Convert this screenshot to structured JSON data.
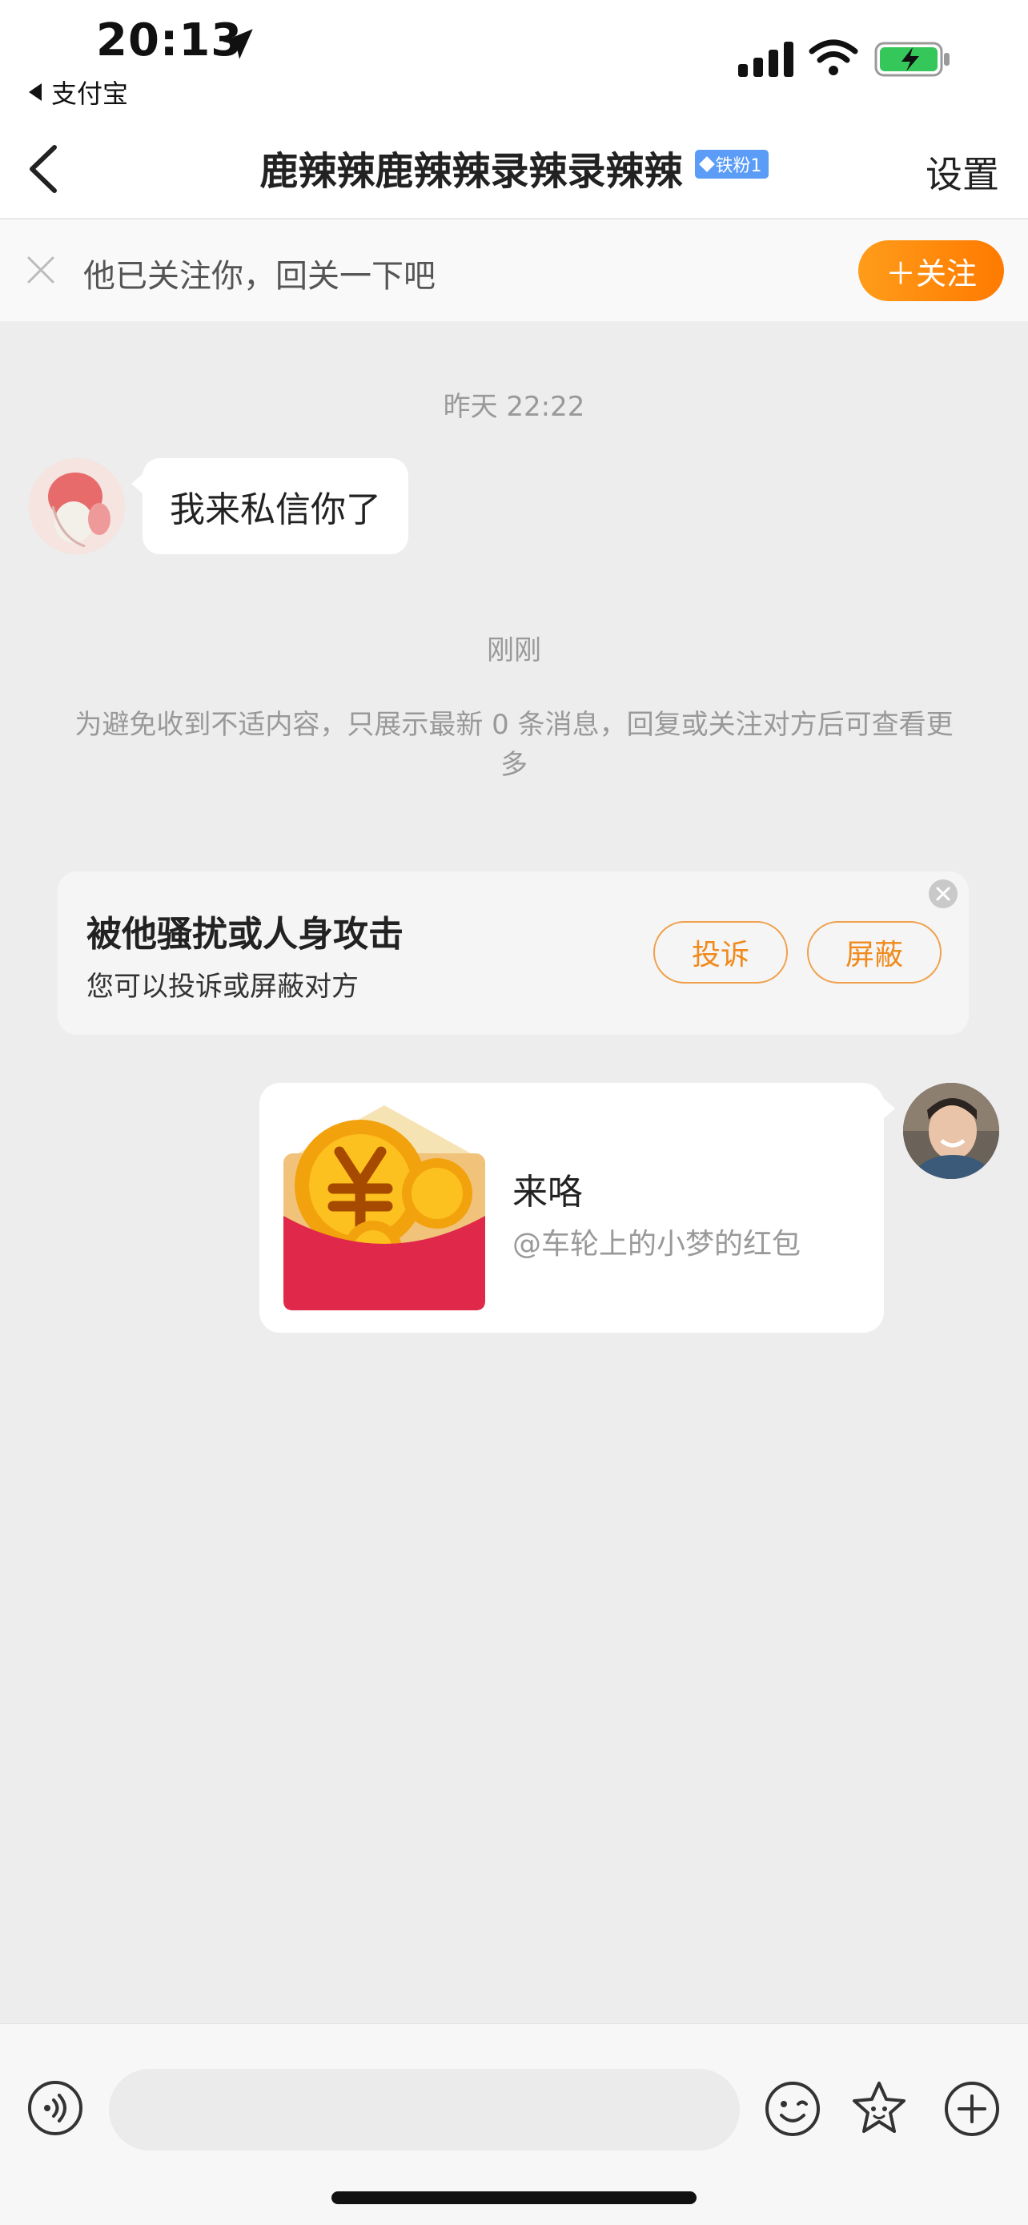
{
  "status_bar": {
    "time": "20:13",
    "back_app": "支付宝"
  },
  "nav": {
    "title": "鹿辣辣鹿辣辣录辣录辣辣",
    "badge": "铁粉1",
    "settings": "设置"
  },
  "follow_banner": {
    "text": "他已关注你，回关一下吧",
    "button": "＋关注"
  },
  "messages": {
    "timestamp_1": "昨天 22:22",
    "incoming_text": "我来私信你了",
    "timestamp_2": "刚刚",
    "notice": "为避免收到不适内容，只展示最新 0 条消息，回复或关注对方后可查看更多"
  },
  "harass_card": {
    "title": "被他骚扰或人身攻击",
    "subtitle": "您可以投诉或屏蔽对方",
    "report_button": "投诉",
    "block_button": "屏蔽"
  },
  "red_packet": {
    "title": "来咯",
    "subtitle": "@车轮上的小梦的红包"
  },
  "input": {
    "placeholder": ""
  },
  "icons": {
    "back": "chevron-left-icon",
    "close": "close-icon",
    "voice": "voice-icon",
    "emoji": "emoji-icon",
    "sticker": "sticker-icon",
    "add": "plus-icon"
  },
  "colors": {
    "accent_orange": "#ff8a00",
    "badge_blue": "#5b9cf6",
    "background": "#ededed"
  }
}
